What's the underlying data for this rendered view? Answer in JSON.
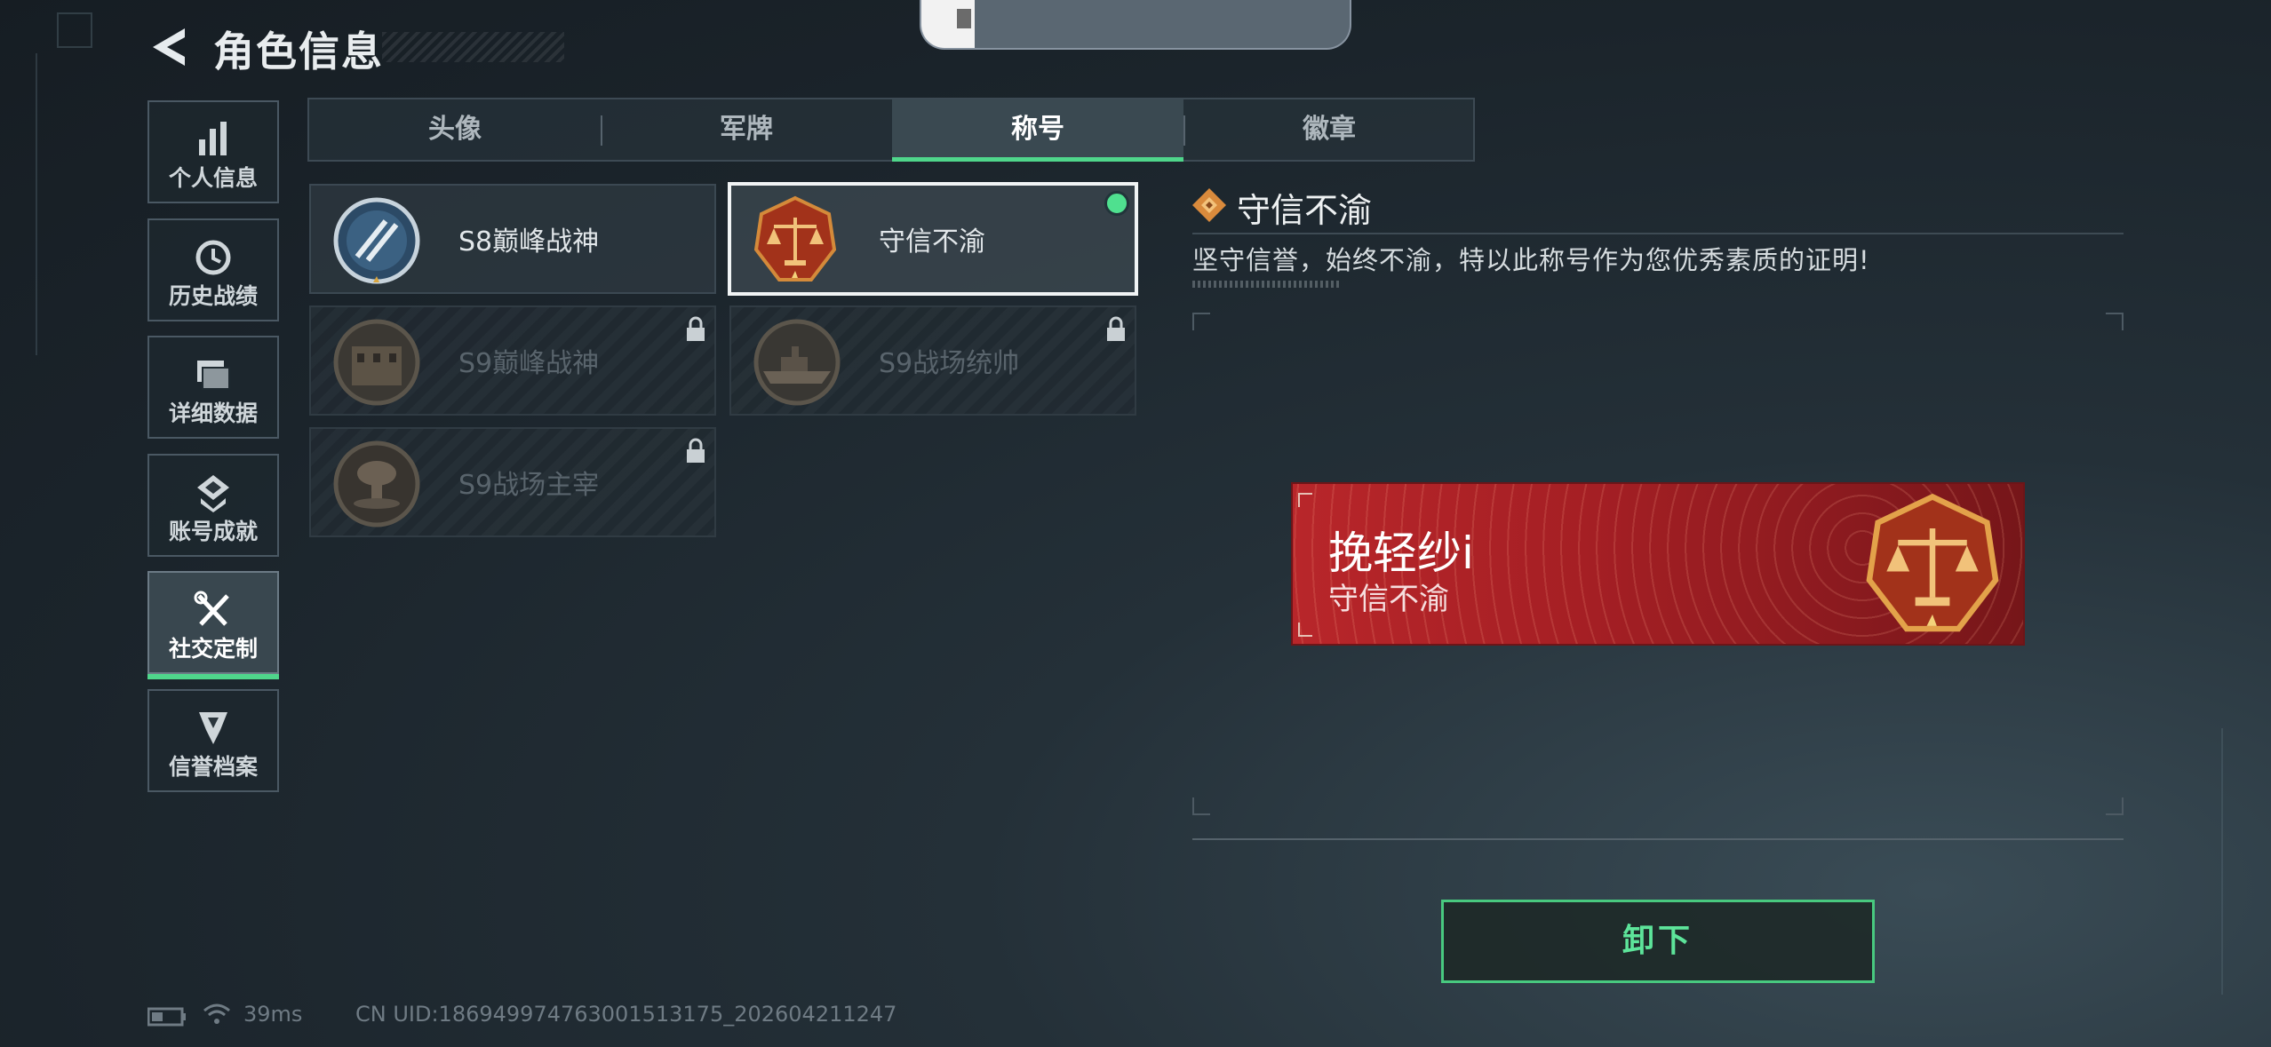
{
  "header": {
    "title": "角色信息"
  },
  "sidebar": {
    "items": [
      {
        "label": "个人信息",
        "icon": "bar-chart-icon",
        "active": false
      },
      {
        "label": "历史战绩",
        "icon": "clock-history-icon",
        "active": false
      },
      {
        "label": "详细数据",
        "icon": "folder-data-icon",
        "active": false
      },
      {
        "label": "账号成就",
        "icon": "achievement-icon",
        "active": false
      },
      {
        "label": "社交定制",
        "icon": "tools-icon",
        "active": true
      },
      {
        "label": "信誉档案",
        "icon": "credit-shield-icon",
        "active": false
      }
    ]
  },
  "tabs": [
    {
      "label": "头像",
      "active": false
    },
    {
      "label": "军牌",
      "active": false
    },
    {
      "label": "称号",
      "active": true
    },
    {
      "label": "徽章",
      "active": false
    }
  ],
  "titles": [
    {
      "name": "S8巅峰战神",
      "locked": false,
      "selected": false,
      "emblem": "blue-stripe-medal-icon"
    },
    {
      "name": "守信不渝",
      "locked": false,
      "selected": true,
      "equipped": true,
      "emblem": "scales-medal-icon"
    },
    {
      "name": "S9巅峰战神",
      "locked": true,
      "selected": false,
      "emblem": "building-medal-icon"
    },
    {
      "name": "S9战场统帅",
      "locked": true,
      "selected": false,
      "emblem": "warship-medal-icon"
    },
    {
      "name": "S9战场主宰",
      "locked": true,
      "selected": false,
      "emblem": "explosion-medal-icon"
    }
  ],
  "detail": {
    "title": "守信不渝",
    "description": "坚守信誉，始终不渝，特以此称号作为您优秀素质的证明!"
  },
  "preview": {
    "player_name": "挽轻纱i",
    "title_text": "守信不渝"
  },
  "actions": {
    "unequip_label": "卸下"
  },
  "status": {
    "ping": "39ms",
    "uid": "CN UID:186949974763001513175_202604211247"
  },
  "colors": {
    "accent_green": "#4fd68b",
    "banner_red": "#b8262a",
    "background": "#1b242b"
  }
}
